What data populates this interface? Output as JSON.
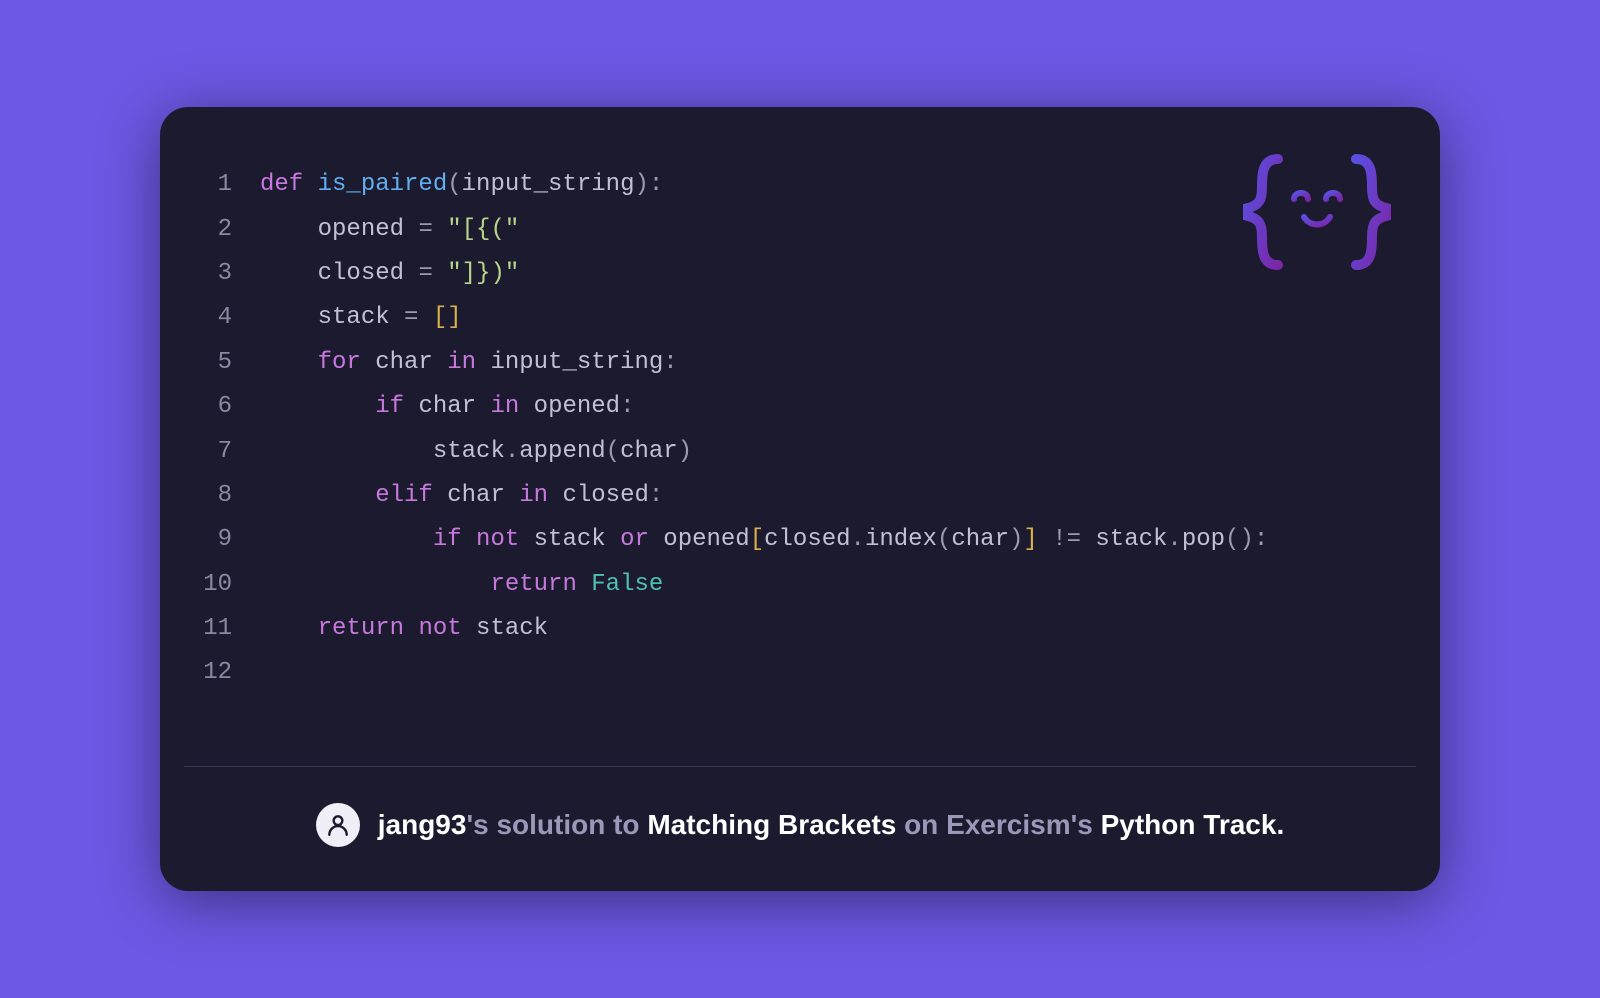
{
  "code": {
    "lines": [
      {
        "n": "1",
        "ind": "",
        "tokens": [
          {
            "c": "kw",
            "t": "def "
          },
          {
            "c": "fn",
            "t": "is_paired"
          },
          {
            "c": "pun",
            "t": "("
          },
          {
            "c": "id",
            "t": "input_string"
          },
          {
            "c": "pun",
            "t": ")"
          },
          {
            "c": "pun",
            "t": ":"
          }
        ]
      },
      {
        "n": "2",
        "ind": "    ",
        "tokens": [
          {
            "c": "id",
            "t": "opened "
          },
          {
            "c": "pun",
            "t": "= "
          },
          {
            "c": "str",
            "t": "\"[{(\""
          }
        ]
      },
      {
        "n": "3",
        "ind": "    ",
        "tokens": [
          {
            "c": "id",
            "t": "closed "
          },
          {
            "c": "pun",
            "t": "= "
          },
          {
            "c": "str",
            "t": "\"]})\""
          }
        ]
      },
      {
        "n": "4",
        "ind": "    ",
        "tokens": [
          {
            "c": "id",
            "t": "stack "
          },
          {
            "c": "pun",
            "t": "= "
          },
          {
            "c": "brk",
            "t": "[]"
          }
        ]
      },
      {
        "n": "5",
        "ind": "    ",
        "tokens": [
          {
            "c": "kw",
            "t": "for "
          },
          {
            "c": "id",
            "t": "char "
          },
          {
            "c": "kw",
            "t": "in "
          },
          {
            "c": "id",
            "t": "input_string"
          },
          {
            "c": "pun",
            "t": ":"
          }
        ]
      },
      {
        "n": "6",
        "ind": "        ",
        "tokens": [
          {
            "c": "kw",
            "t": "if "
          },
          {
            "c": "id",
            "t": "char "
          },
          {
            "c": "kw",
            "t": "in "
          },
          {
            "c": "id",
            "t": "opened"
          },
          {
            "c": "pun",
            "t": ":"
          }
        ]
      },
      {
        "n": "7",
        "ind": "            ",
        "tokens": [
          {
            "c": "id",
            "t": "stack"
          },
          {
            "c": "pun",
            "t": "."
          },
          {
            "c": "id",
            "t": "append"
          },
          {
            "c": "pun",
            "t": "("
          },
          {
            "c": "id",
            "t": "char"
          },
          {
            "c": "pun",
            "t": ")"
          }
        ]
      },
      {
        "n": "8",
        "ind": "        ",
        "tokens": [
          {
            "c": "kw",
            "t": "elif "
          },
          {
            "c": "id",
            "t": "char "
          },
          {
            "c": "kw",
            "t": "in "
          },
          {
            "c": "id",
            "t": "closed"
          },
          {
            "c": "pun",
            "t": ":"
          }
        ]
      },
      {
        "n": "9",
        "ind": "            ",
        "tokens": [
          {
            "c": "kw",
            "t": "if "
          },
          {
            "c": "kw",
            "t": "not "
          },
          {
            "c": "id",
            "t": "stack "
          },
          {
            "c": "kw",
            "t": "or "
          },
          {
            "c": "id",
            "t": "opened"
          },
          {
            "c": "brk",
            "t": "["
          },
          {
            "c": "id",
            "t": "closed"
          },
          {
            "c": "pun",
            "t": "."
          },
          {
            "c": "id",
            "t": "index"
          },
          {
            "c": "pun",
            "t": "("
          },
          {
            "c": "id",
            "t": "char"
          },
          {
            "c": "pun",
            "t": ")"
          },
          {
            "c": "brk",
            "t": "]"
          },
          {
            "c": "pun",
            "t": " != "
          },
          {
            "c": "id",
            "t": "stack"
          },
          {
            "c": "pun",
            "t": "."
          },
          {
            "c": "id",
            "t": "pop"
          },
          {
            "c": "pun",
            "t": "()"
          },
          {
            "c": "pun",
            "t": ":"
          }
        ]
      },
      {
        "n": "10",
        "ind": "                ",
        "tokens": [
          {
            "c": "kw",
            "t": "return "
          },
          {
            "c": "con",
            "t": "False"
          }
        ]
      },
      {
        "n": "11",
        "ind": "    ",
        "tokens": [
          {
            "c": "kw",
            "t": "return "
          },
          {
            "c": "kw",
            "t": "not "
          },
          {
            "c": "id",
            "t": "stack"
          }
        ]
      },
      {
        "n": "12",
        "ind": "",
        "tokens": []
      }
    ]
  },
  "footer": {
    "username": "jang93",
    "phrase_solution_to": "'s solution to ",
    "exercise": "Matching Brackets",
    "phrase_on": " on Exercism's ",
    "track": "Python Track",
    "period": "."
  }
}
